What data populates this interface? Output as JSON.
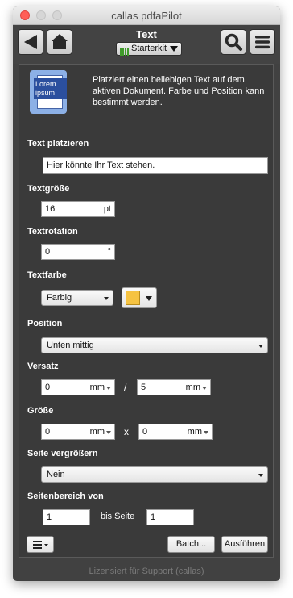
{
  "window": {
    "title": "callas pdfaPilot"
  },
  "toolbar": {
    "title": "Text",
    "kit_label": "Starterkit",
    "icons": [
      "back-arrow-icon",
      "home-icon",
      "search-icon",
      "menu-icon"
    ]
  },
  "panel": {
    "icon_text": "Lorem ipsum",
    "description": "Platziert einen beliebigen Text auf dem aktiven Dokument. Farbe und Position kann bestimmt werden.",
    "text_label": "Text platzieren",
    "text_value": "Hier könnte Ihr Text stehen.",
    "size_label": "Textgröße",
    "size_value": "16",
    "size_unit": "pt",
    "rotation_label": "Textrotation",
    "rotation_value": "0",
    "rotation_unit": "°",
    "color_label": "Textfarbe",
    "color_mode": "Farbig",
    "color_swatch": "#f6c342",
    "position_label": "Position",
    "position_value": "Unten mittig",
    "offset_label": "Versatz",
    "offset_x": "0",
    "offset_y": "5",
    "offset_unit": "mm",
    "offset_sep": "/",
    "dims_label": "Größe",
    "dims_w": "0",
    "dims_h": "0",
    "dims_unit": "mm",
    "dims_sep": "x",
    "enlarge_label": "Seite vergrößern",
    "enlarge_value": "Nein",
    "range_label": "Seitenbereich von",
    "range_from": "1",
    "range_to_label": "bis Seite",
    "range_to": "1"
  },
  "footer": {
    "batch_label": "Batch...",
    "run_label": "Ausführen"
  },
  "status": "Lizensiert für Support (callas)"
}
